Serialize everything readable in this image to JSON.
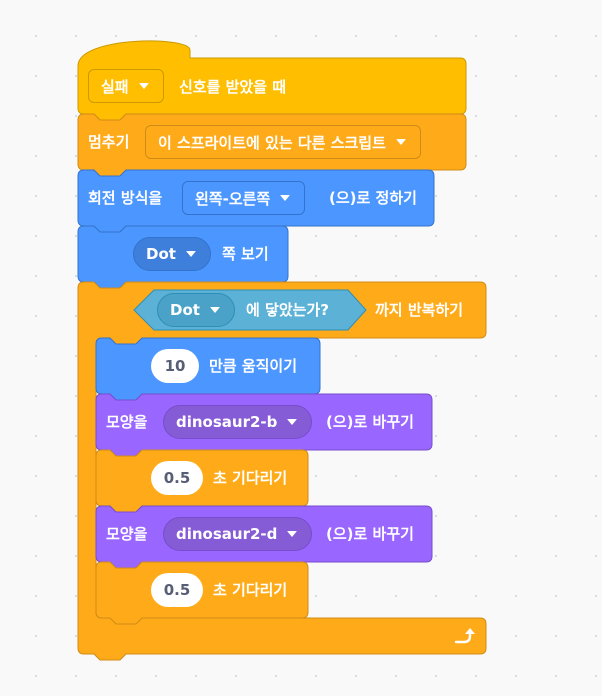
{
  "colors": {
    "events": "#ffbf00",
    "control": "#ffab19",
    "motion": "#4c97ff",
    "looks": "#9966ff",
    "sensing": "#5cb1d6"
  },
  "script": {
    "hat": {
      "dropdown": "실패",
      "text": "신호를 받았을 때"
    },
    "stop": {
      "text": "멈추기",
      "dropdown": "이 스프라이트에 있는 다른 스크립트"
    },
    "rotation": {
      "prefix": "회전 방식을",
      "dropdown": "왼쪽-오른쪽",
      "suffix": "(으)로 정하기"
    },
    "point_towards": {
      "dropdown": "Dot",
      "suffix": "쪽 보기"
    },
    "repeat_until": {
      "condition": {
        "dropdown": "Dot",
        "text": "에 닿았는가?"
      },
      "suffix": "까지 반복하기",
      "loop_arrow_icon": "loop-arrow"
    },
    "move": {
      "value": "10",
      "suffix": "만큼 움직이기"
    },
    "costume1": {
      "prefix": "모양을",
      "dropdown": "dinosaur2-b",
      "suffix": "(으)로 바꾸기"
    },
    "wait1": {
      "value": "0.5",
      "suffix": "초 기다리기"
    },
    "costume2": {
      "prefix": "모양을",
      "dropdown": "dinosaur2-d",
      "suffix": "(으)로 바꾸기"
    },
    "wait2": {
      "value": "0.5",
      "suffix": "초 기다리기"
    }
  }
}
